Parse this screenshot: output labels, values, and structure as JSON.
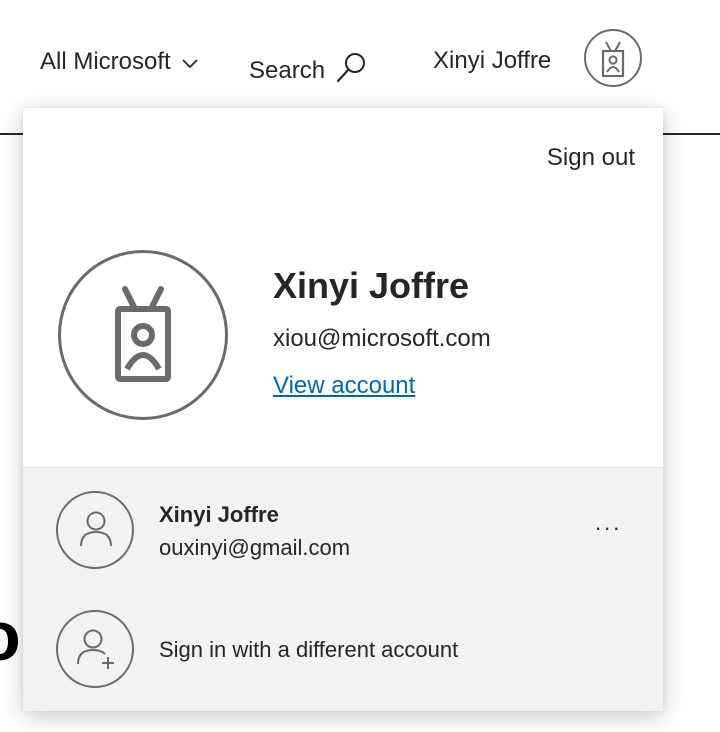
{
  "header": {
    "all_microsoft_label": "All Microsoft",
    "search_label": "Search",
    "user_name": "Xinyi Joffre"
  },
  "background": {
    "partial_glyph": "o"
  },
  "account_panel": {
    "sign_out_label": "Sign out",
    "primary_account": {
      "name": "Xinyi Joffre",
      "email": "xiou@microsoft.com",
      "view_account_label": "View account"
    },
    "other_account": {
      "name": "Xinyi Joffre",
      "email": "ouxinyi@gmail.com",
      "more_label": "..."
    },
    "sign_in_different_label": "Sign in with a different account"
  },
  "icons": {
    "header_avatar": "badge-avatar-icon",
    "search": "search-icon",
    "chevron": "chevron-down-icon",
    "other_avatar": "person-icon",
    "add_account": "person-add-icon"
  },
  "colors": {
    "link": "#0067b8",
    "lower_section_bg": "#f2f2f2",
    "icon_stroke": "#6b6b6b"
  }
}
